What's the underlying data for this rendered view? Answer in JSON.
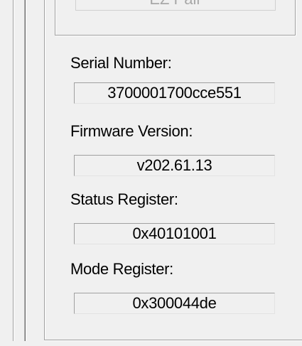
{
  "top_button": {
    "label": "EZ Pair"
  },
  "device_info": {
    "serial_number": {
      "label": "Serial Number:",
      "value": "3700001700cce551"
    },
    "firmware_version": {
      "label": "Firmware Version:",
      "value": "v202.61.13"
    },
    "status_register": {
      "label": "Status Register:",
      "value": "0x40101001"
    },
    "mode_register": {
      "label": "Mode Register:",
      "value": "0x300044de"
    }
  }
}
